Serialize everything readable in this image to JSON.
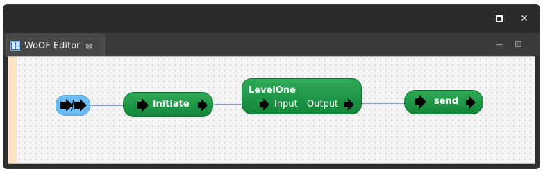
{
  "window": {
    "maximize_icon": "maximize-icon",
    "close_label": "✕"
  },
  "tab": {
    "label": "WoOF Editor",
    "icon": "woof-editor-icon",
    "close_label": "⊠"
  },
  "panel_controls": {
    "minimize_icon": "minimize-icon",
    "maximize_icon": "maximize-icon"
  },
  "flow": {
    "start_node": {
      "icon": "start-arrows-icon"
    },
    "nodes": [
      {
        "name": "initiate",
        "label": "initiate"
      },
      {
        "name": "LevelOne",
        "label": "LevelOne",
        "input_label": "Input",
        "output_label": "Output"
      },
      {
        "name": "send",
        "label": "send"
      }
    ]
  },
  "colors": {
    "node_green": "#1a9645",
    "start_node_blue": "#6ebcf5",
    "wire": "#7b9be3",
    "canvas": "#f4f4f4",
    "left_strip": "#fde3c4"
  }
}
